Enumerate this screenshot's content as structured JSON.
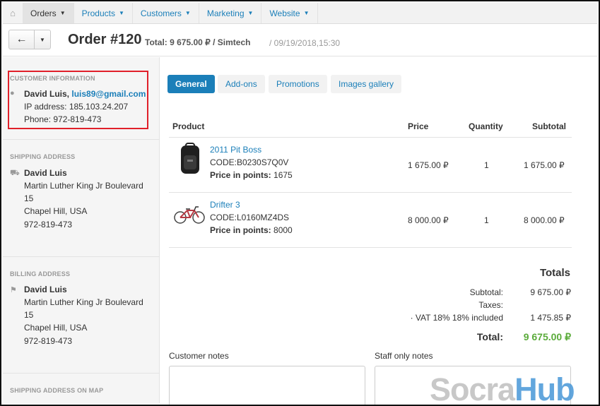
{
  "nav": {
    "items": [
      {
        "label": "Orders",
        "active": true
      },
      {
        "label": "Products"
      },
      {
        "label": "Customers"
      },
      {
        "label": "Marketing"
      },
      {
        "label": "Website"
      }
    ]
  },
  "header": {
    "title": "Order #120",
    "total": "Total: 9 675.00 ₽ / Simtech",
    "date": "/ 09/19/2018,15:30"
  },
  "customer": {
    "section_label": "CUSTOMER INFORMATION",
    "name": "David Luis,",
    "email": "luis89@gmail.com",
    "ip": "IP address: 185.103.24.207",
    "phone": "Phone: 972-819-473"
  },
  "shipping": {
    "section_label": "SHIPPING ADDRESS",
    "name": "David Luis",
    "street": "Martin Luther King Jr Boulevard",
    "number": "15",
    "city": "Chapel Hill, USA",
    "phone": "972-819-473"
  },
  "billing": {
    "section_label": "BILLING ADDRESS",
    "name": "David Luis",
    "street": "Martin Luther King Jr Boulevard",
    "number": "15",
    "city": "Chapel Hill, USA",
    "phone": "972-819-473"
  },
  "map": {
    "section_label": "SHIPPING ADDRESS ON MAP"
  },
  "tabs": [
    "General",
    "Add-ons",
    "Promotions",
    "Images gallery"
  ],
  "table": {
    "headers": [
      "Product",
      "Price",
      "Quantity",
      "Subtotal"
    ],
    "rows": [
      {
        "name": "2011 Pit Boss",
        "code": "CODE:B0230S7Q0V",
        "points_label": "Price in points:",
        "points": "1675",
        "price": "1 675.00 ₽",
        "qty": "1",
        "subtotal": "1 675.00 ₽"
      },
      {
        "name": "Drifter 3",
        "code": "CODE:L0160MZ4DS",
        "points_label": "Price in points:",
        "points": "8000",
        "price": "8 000.00 ₽",
        "qty": "1",
        "subtotal": "8 000.00 ₽"
      }
    ]
  },
  "totals": {
    "heading": "Totals",
    "subtotal_label": "Subtotal:",
    "subtotal": "9 675.00 ₽",
    "taxes_label": "Taxes:",
    "vat_label": "· VAT 18% 18% included",
    "vat": "1 475.85 ₽",
    "total_label": "Total:",
    "total": "9 675.00 ₽",
    "total_color": "#5aab3a"
  },
  "notes": {
    "customer_label": "Customer notes",
    "staff_label": "Staff only notes"
  },
  "watermark": {
    "part1": "Socra",
    "part2": "Hub"
  }
}
